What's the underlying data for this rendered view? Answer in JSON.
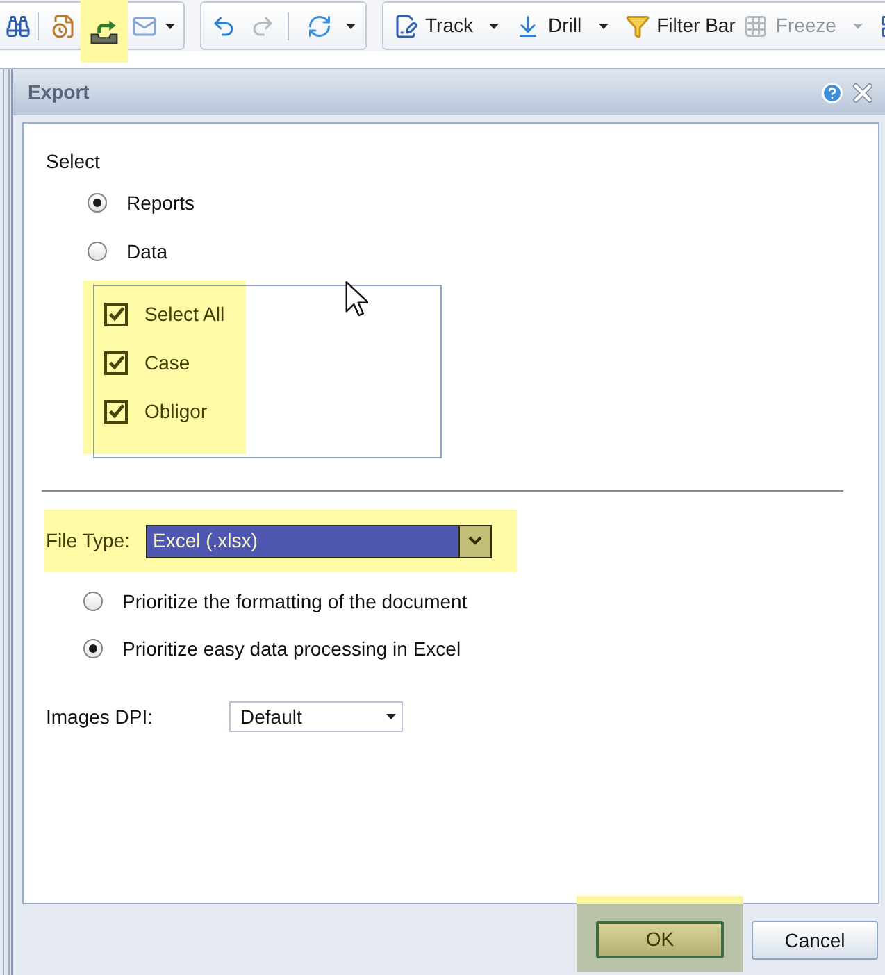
{
  "toolbar": {
    "groups": [
      {
        "items": [
          {
            "kind": "button",
            "disabled": false,
            "highlighted": false,
            "dropdown": false
          },
          {
            "kind": "separator"
          },
          {
            "kind": "button",
            "disabled": false,
            "highlighted": false,
            "dropdown": false
          },
          {
            "kind": "button",
            "disabled": false,
            "highlighted": true,
            "dropdown": false
          },
          {
            "kind": "button",
            "disabled": false,
            "highlighted": false,
            "dropdown": true
          }
        ]
      },
      {
        "items": [
          {
            "kind": "button",
            "disabled": false,
            "highlighted": false,
            "dropdown": false
          },
          {
            "kind": "button",
            "disabled": true,
            "highlighted": false,
            "dropdown": false
          },
          {
            "kind": "separator"
          },
          {
            "kind": "button",
            "disabled": false,
            "highlighted": false,
            "dropdown": true
          }
        ]
      },
      {
        "items": [
          {
            "kind": "button",
            "label": "Track",
            "disabled": false,
            "highlighted": false,
            "dropdown": true
          },
          {
            "kind": "button",
            "label": "Drill",
            "disabled": false,
            "highlighted": false,
            "dropdown": true
          },
          {
            "kind": "button",
            "label": "Filter Bar",
            "disabled": false,
            "highlighted": false,
            "dropdown": false
          },
          {
            "kind": "button",
            "label": "Freeze",
            "disabled": true,
            "highlighted": false,
            "dropdown": true
          },
          {
            "kind": "button",
            "disabled": false,
            "highlighted": false,
            "dropdown": false
          }
        ]
      }
    ]
  },
  "dialog": {
    "title": "Export",
    "select_label": "Select",
    "content_types": [
      {
        "label": "Reports",
        "selected": true
      },
      {
        "label": "Data",
        "selected": false
      }
    ],
    "report_list": {
      "highlighted": true,
      "items": [
        {
          "label": "Select All",
          "checked": true
        },
        {
          "label": "Case",
          "checked": true
        },
        {
          "label": "Obligor",
          "checked": true
        }
      ]
    },
    "file_type": {
      "label": "File Type:",
      "value": "Excel (.xlsx)",
      "highlighted": true
    },
    "excel_options": [
      {
        "label": "Prioritize the formatting of the document",
        "selected": false
      },
      {
        "label": "Prioritize easy data processing in Excel",
        "selected": true
      }
    ],
    "images_dpi": {
      "label": "Images DPI:",
      "value": "Default"
    },
    "buttons": [
      {
        "label": "OK",
        "highlighted": true
      },
      {
        "label": "Cancel",
        "highlighted": false
      }
    ]
  }
}
